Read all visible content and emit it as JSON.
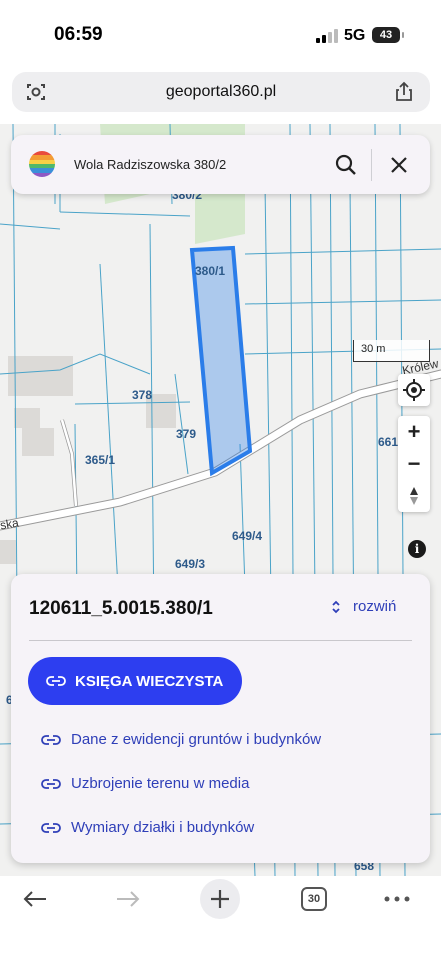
{
  "status_bar": {
    "time": "06:59",
    "network": "5G",
    "battery": "43"
  },
  "browser": {
    "url": "geoportal360.pl",
    "tab_count": "30"
  },
  "search": {
    "query": "Wola Radziszowska 380/2"
  },
  "map": {
    "scale_label": "30 m",
    "plot_labels": [
      "380/2",
      "380/1",
      "378",
      "379",
      "365/1",
      "649/4",
      "649/3",
      "661",
      "658",
      "6"
    ],
    "street_labels": [
      "ska",
      "Królew"
    ],
    "highlight_color": "#2b7de9"
  },
  "parcel_panel": {
    "title": "120611_5.0015.380/1",
    "expand_label": "rozwiń",
    "primary_button": "KSIĘGA WIECZYSTA",
    "links": [
      "Dane z ewidencji gruntów i budynków",
      "Uzbrojenie terenu w media",
      "Wymiary działki i budynków"
    ]
  },
  "colors": {
    "accent": "#2d3ef0",
    "link": "#2f3fb8"
  }
}
